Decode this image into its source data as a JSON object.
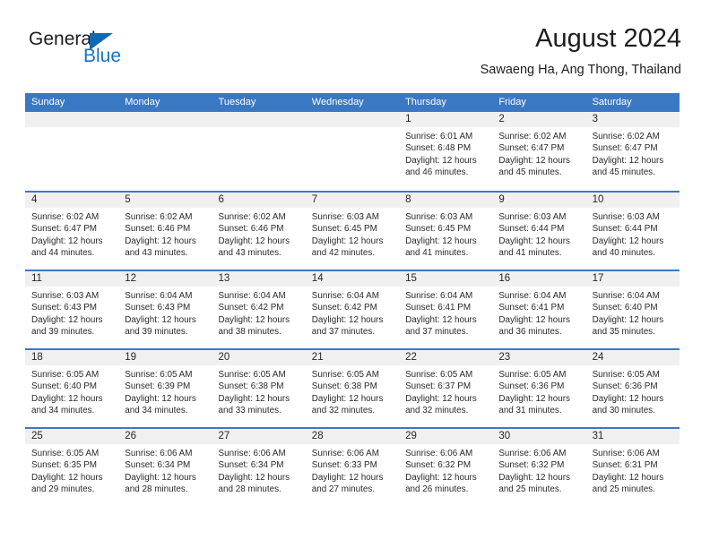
{
  "brand": {
    "name_part1": "General",
    "name_part2": "Blue",
    "triangle_icon": "triangle-icon",
    "color_dark": "#1d1d1d",
    "color_blue": "#1673c4"
  },
  "header": {
    "month_title": "August 2024",
    "location": "Sawaeng Ha, Ang Thong, Thailand"
  },
  "theme": {
    "header_blue": "#3b78c3",
    "daynum_band": "#f0f0f0",
    "text": "#222222"
  },
  "weekday_headers": [
    "Sunday",
    "Monday",
    "Tuesday",
    "Wednesday",
    "Thursday",
    "Friday",
    "Saturday"
  ],
  "weeks": [
    [
      {
        "day": "",
        "lines": []
      },
      {
        "day": "",
        "lines": []
      },
      {
        "day": "",
        "lines": []
      },
      {
        "day": "",
        "lines": []
      },
      {
        "day": "1",
        "lines": [
          "Sunrise: 6:01 AM",
          "Sunset: 6:48 PM",
          "Daylight: 12 hours",
          "and 46 minutes."
        ]
      },
      {
        "day": "2",
        "lines": [
          "Sunrise: 6:02 AM",
          "Sunset: 6:47 PM",
          "Daylight: 12 hours",
          "and 45 minutes."
        ]
      },
      {
        "day": "3",
        "lines": [
          "Sunrise: 6:02 AM",
          "Sunset: 6:47 PM",
          "Daylight: 12 hours",
          "and 45 minutes."
        ]
      }
    ],
    [
      {
        "day": "4",
        "lines": [
          "Sunrise: 6:02 AM",
          "Sunset: 6:47 PM",
          "Daylight: 12 hours",
          "and 44 minutes."
        ]
      },
      {
        "day": "5",
        "lines": [
          "Sunrise: 6:02 AM",
          "Sunset: 6:46 PM",
          "Daylight: 12 hours",
          "and 43 minutes."
        ]
      },
      {
        "day": "6",
        "lines": [
          "Sunrise: 6:02 AM",
          "Sunset: 6:46 PM",
          "Daylight: 12 hours",
          "and 43 minutes."
        ]
      },
      {
        "day": "7",
        "lines": [
          "Sunrise: 6:03 AM",
          "Sunset: 6:45 PM",
          "Daylight: 12 hours",
          "and 42 minutes."
        ]
      },
      {
        "day": "8",
        "lines": [
          "Sunrise: 6:03 AM",
          "Sunset: 6:45 PM",
          "Daylight: 12 hours",
          "and 41 minutes."
        ]
      },
      {
        "day": "9",
        "lines": [
          "Sunrise: 6:03 AM",
          "Sunset: 6:44 PM",
          "Daylight: 12 hours",
          "and 41 minutes."
        ]
      },
      {
        "day": "10",
        "lines": [
          "Sunrise: 6:03 AM",
          "Sunset: 6:44 PM",
          "Daylight: 12 hours",
          "and 40 minutes."
        ]
      }
    ],
    [
      {
        "day": "11",
        "lines": [
          "Sunrise: 6:03 AM",
          "Sunset: 6:43 PM",
          "Daylight: 12 hours",
          "and 39 minutes."
        ]
      },
      {
        "day": "12",
        "lines": [
          "Sunrise: 6:04 AM",
          "Sunset: 6:43 PM",
          "Daylight: 12 hours",
          "and 39 minutes."
        ]
      },
      {
        "day": "13",
        "lines": [
          "Sunrise: 6:04 AM",
          "Sunset: 6:42 PM",
          "Daylight: 12 hours",
          "and 38 minutes."
        ]
      },
      {
        "day": "14",
        "lines": [
          "Sunrise: 6:04 AM",
          "Sunset: 6:42 PM",
          "Daylight: 12 hours",
          "and 37 minutes."
        ]
      },
      {
        "day": "15",
        "lines": [
          "Sunrise: 6:04 AM",
          "Sunset: 6:41 PM",
          "Daylight: 12 hours",
          "and 37 minutes."
        ]
      },
      {
        "day": "16",
        "lines": [
          "Sunrise: 6:04 AM",
          "Sunset: 6:41 PM",
          "Daylight: 12 hours",
          "and 36 minutes."
        ]
      },
      {
        "day": "17",
        "lines": [
          "Sunrise: 6:04 AM",
          "Sunset: 6:40 PM",
          "Daylight: 12 hours",
          "and 35 minutes."
        ]
      }
    ],
    [
      {
        "day": "18",
        "lines": [
          "Sunrise: 6:05 AM",
          "Sunset: 6:40 PM",
          "Daylight: 12 hours",
          "and 34 minutes."
        ]
      },
      {
        "day": "19",
        "lines": [
          "Sunrise: 6:05 AM",
          "Sunset: 6:39 PM",
          "Daylight: 12 hours",
          "and 34 minutes."
        ]
      },
      {
        "day": "20",
        "lines": [
          "Sunrise: 6:05 AM",
          "Sunset: 6:38 PM",
          "Daylight: 12 hours",
          "and 33 minutes."
        ]
      },
      {
        "day": "21",
        "lines": [
          "Sunrise: 6:05 AM",
          "Sunset: 6:38 PM",
          "Daylight: 12 hours",
          "and 32 minutes."
        ]
      },
      {
        "day": "22",
        "lines": [
          "Sunrise: 6:05 AM",
          "Sunset: 6:37 PM",
          "Daylight: 12 hours",
          "and 32 minutes."
        ]
      },
      {
        "day": "23",
        "lines": [
          "Sunrise: 6:05 AM",
          "Sunset: 6:36 PM",
          "Daylight: 12 hours",
          "and 31 minutes."
        ]
      },
      {
        "day": "24",
        "lines": [
          "Sunrise: 6:05 AM",
          "Sunset: 6:36 PM",
          "Daylight: 12 hours",
          "and 30 minutes."
        ]
      }
    ],
    [
      {
        "day": "25",
        "lines": [
          "Sunrise: 6:05 AM",
          "Sunset: 6:35 PM",
          "Daylight: 12 hours",
          "and 29 minutes."
        ]
      },
      {
        "day": "26",
        "lines": [
          "Sunrise: 6:06 AM",
          "Sunset: 6:34 PM",
          "Daylight: 12 hours",
          "and 28 minutes."
        ]
      },
      {
        "day": "27",
        "lines": [
          "Sunrise: 6:06 AM",
          "Sunset: 6:34 PM",
          "Daylight: 12 hours",
          "and 28 minutes."
        ]
      },
      {
        "day": "28",
        "lines": [
          "Sunrise: 6:06 AM",
          "Sunset: 6:33 PM",
          "Daylight: 12 hours",
          "and 27 minutes."
        ]
      },
      {
        "day": "29",
        "lines": [
          "Sunrise: 6:06 AM",
          "Sunset: 6:32 PM",
          "Daylight: 12 hours",
          "and 26 minutes."
        ]
      },
      {
        "day": "30",
        "lines": [
          "Sunrise: 6:06 AM",
          "Sunset: 6:32 PM",
          "Daylight: 12 hours",
          "and 25 minutes."
        ]
      },
      {
        "day": "31",
        "lines": [
          "Sunrise: 6:06 AM",
          "Sunset: 6:31 PM",
          "Daylight: 12 hours",
          "and 25 minutes."
        ]
      }
    ]
  ]
}
